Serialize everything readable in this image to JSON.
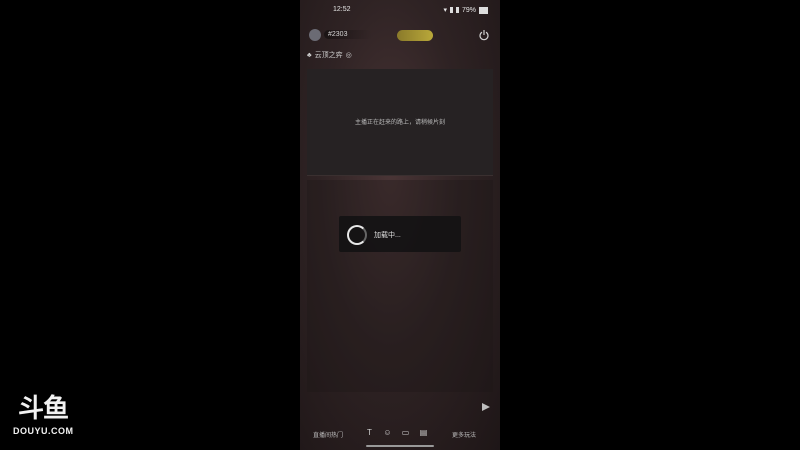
{
  "status_bar": {
    "time": "12:52",
    "battery": "79%"
  },
  "topbar": {
    "username": "#2303",
    "badge": "",
    "extra": ""
  },
  "room": {
    "label": "云顶之弈"
  },
  "video": {
    "message": "主播正在赶来的路上，请稍候片刻"
  },
  "loading": {
    "text": "加载中..."
  },
  "input": {
    "placeholder": ""
  },
  "bottom_bar": {
    "left_label": "直播间热门",
    "right_label": "更多玩法"
  },
  "watermark": {
    "logo": "斗鱼",
    "text": "DOUYU.COM"
  }
}
